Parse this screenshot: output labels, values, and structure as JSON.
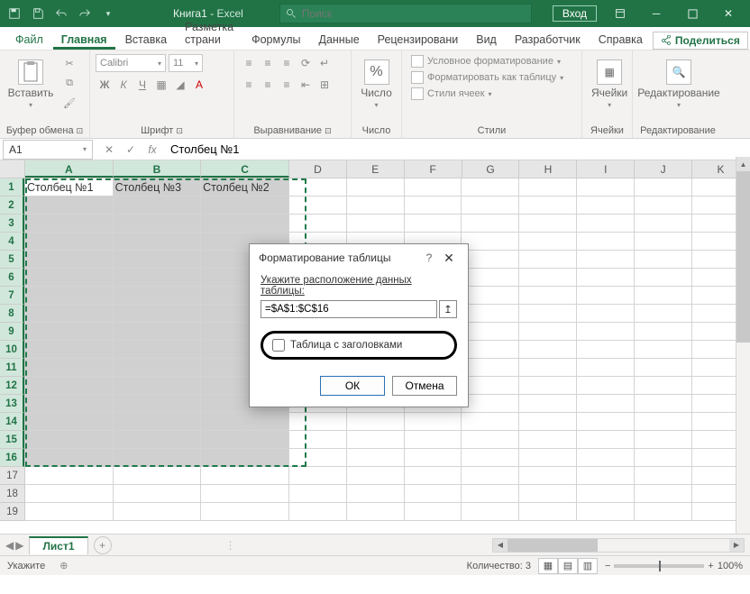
{
  "titlebar": {
    "doc_name": "Книга1",
    "app_name": "Excel",
    "search_placeholder": "Поиск",
    "login": "Вход"
  },
  "tabs": {
    "file": "Файл",
    "items": [
      "Главная",
      "Вставка",
      "Разметка страни",
      "Формулы",
      "Данные",
      "Рецензировани",
      "Вид",
      "Разработчик",
      "Справка"
    ],
    "share": "Поделиться"
  },
  "ribbon": {
    "clipboard": {
      "paste": "Вставить",
      "label": "Буфер обмена"
    },
    "font": {
      "name": "Calibri",
      "size": "11",
      "label": "Шрифт"
    },
    "align": {
      "label": "Выравнивание"
    },
    "number": {
      "big": "Число",
      "label": "Число"
    },
    "styles": {
      "cond": "Условное форматирование",
      "table": "Форматировать как таблицу",
      "cell": "Стили ячеек",
      "label": "Стили"
    },
    "cells": {
      "label": "Ячейки"
    },
    "editing": {
      "label": "Редактирование"
    }
  },
  "formula_bar": {
    "name": "A1",
    "value": "Столбец №1"
  },
  "grid": {
    "cols": [
      "A",
      "B",
      "C",
      "D",
      "E",
      "F",
      "G",
      "H",
      "I",
      "J",
      "K"
    ],
    "rows": [
      "1",
      "2",
      "3",
      "4",
      "5",
      "6",
      "7",
      "8",
      "9",
      "10",
      "11",
      "12",
      "13",
      "14",
      "15",
      "16",
      "17",
      "18",
      "19"
    ],
    "headers": [
      "Столбец №1",
      "Столбец №3",
      "Столбец №2"
    ]
  },
  "dialog": {
    "title": "Форматирование таблицы",
    "prompt": "Укажите расположение данных таблицы:",
    "range": "=$A$1:$C$16",
    "checkbox": "Таблица с заголовками",
    "ok": "ОК",
    "cancel": "Отмена"
  },
  "sheet": {
    "name": "Лист1"
  },
  "status": {
    "mode": "Укажите",
    "count_label": "Количество:",
    "count": "3",
    "zoom": "100%"
  }
}
